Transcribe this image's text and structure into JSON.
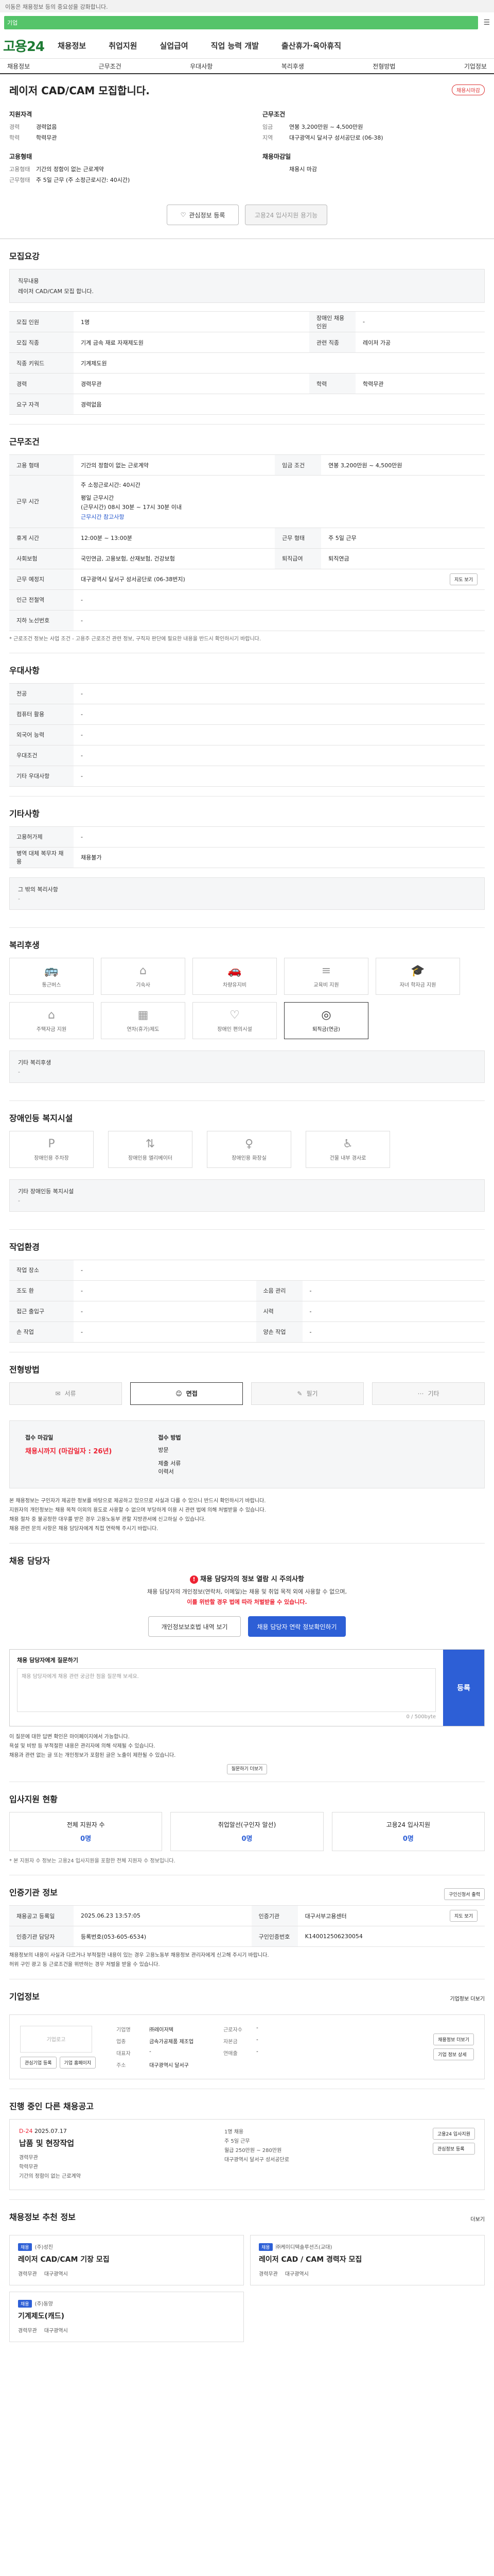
{
  "top_note": "이동은 채용정보 등의 중요성을 강화합니다.",
  "search": {
    "text": "기업"
  },
  "header": {
    "logo": "고용24",
    "nav": [
      "채용정보",
      "취업지원",
      "실업급여",
      "직업 능력 개발",
      "출산휴가·육아휴직"
    ]
  },
  "subnav": [
    "채용정보",
    "근무조건",
    "우대사항",
    "복리후생",
    "전형방법",
    "기업정보"
  ],
  "job": {
    "title": "레이저 CAD/CAM 모집합니다.",
    "badge": "채용시마감",
    "left_groups": [
      {
        "title": "지원자격",
        "rows": [
          {
            "k": "경력",
            "v": "경력없음"
          },
          {
            "k": "학력",
            "v": "학력무관"
          }
        ]
      },
      {
        "title": "고용형태",
        "rows": [
          {
            "k": "고용형태",
            "v": "기간의 정함이 없는 근로계약"
          },
          {
            "k": "근무형태",
            "v": "주 5일 근무 (주 소정근로시간: 40시간)"
          }
        ]
      }
    ],
    "right_groups": [
      {
        "title": "근무조건",
        "rows": [
          {
            "k": "임금",
            "v": "연봉 3,200만원 ~ 4,500만원"
          },
          {
            "k": "지역",
            "v": "대구광역시 달서구 성서공단로 (06-38)"
          }
        ]
      },
      {
        "title": "채용마감일",
        "rows": [
          {
            "k": "",
            "v": "채용시 마감"
          }
        ]
      }
    ],
    "actions": {
      "save": "관심정보 등록",
      "compare": "고용24 입사지원 용기능"
    }
  },
  "recruit": {
    "title": "모집요강",
    "job_label": "직무내용",
    "job_desc": "레이저 CAD/CAM 모집 합니다.",
    "rows": [
      [
        "모집 인원",
        "1명",
        "장애인 채용 인원",
        "-"
      ],
      [
        "모집 직종",
        "기계 금속 재료 자재제도원",
        "관련 직종",
        "레이저 가공"
      ],
      [
        "직종 키워드",
        "기계제도원",
        "",
        ""
      ],
      [
        "경력",
        "경력무관",
        "학력",
        "학력무관"
      ],
      [
        "요구 자격",
        "경력없음",
        "",
        ""
      ]
    ]
  },
  "conditions": {
    "title": "근무조건",
    "rows_top": [
      [
        "고용 형태",
        "기간의 정함이 없는 근로계약",
        "임금 조건",
        "연봉 3,200만원 ~ 4,500만원"
      ]
    ],
    "hours_label": "근무 시간",
    "hours": [
      "주 소정근로시간: 40시간",
      "",
      "평일 근무시간",
      "(근무시간) 08시 30분 ~ 17시 30분 이내",
      "근무시간 참고사항"
    ],
    "rows_mid": [
      [
        "휴게 시간",
        "12:00분 ~ 13:00분",
        "근무 형태",
        "주 5일 근무"
      ],
      [
        "사회보험",
        "국민연금, 고용보험, 산재보험, 건강보험",
        "퇴직급여",
        "퇴직연금"
      ]
    ],
    "address_label": "근무 예정지",
    "address": "대구광역시 달서구 성서공단로 (06-38번지)",
    "map_btn": "지도 보기",
    "rows_bottom": [
      [
        "인근 전철역",
        "-"
      ],
      [
        "지하 노선번호",
        "-"
      ]
    ],
    "note": "* 근로조건 정보는 사업 조건 - 고용주 근로조건 관련 정보, 구직자 판단에 필요한 내용을 반드시 확인하시기 바랍니다."
  },
  "prefer": {
    "title": "우대사항",
    "rows": [
      [
        "전공",
        "-"
      ],
      [
        "컴퓨터 활용",
        "-"
      ],
      [
        "외국어 능력",
        "-"
      ],
      [
        "우대조건",
        "-"
      ],
      [
        "기타 우대사항",
        "-"
      ]
    ]
  },
  "other": {
    "title": "기타사항",
    "rows": [
      [
        "고용허가제",
        "-"
      ],
      [
        "병역 대체 복무자 채용",
        "채용불가"
      ]
    ],
    "etc_label": "그 밖의 복리사항",
    "etc_value": "-"
  },
  "welfare": {
    "title": "복리후생",
    "items": [
      {
        "label": "통근버스",
        "icon": "bus",
        "on": false
      },
      {
        "label": "기숙사",
        "icon": "home",
        "on": false
      },
      {
        "label": "차량유지비",
        "icon": "car",
        "on": false
      },
      {
        "label": "교육비 지원",
        "icon": "book",
        "on": false
      },
      {
        "label": "자녀 학자금 지원",
        "icon": "cap",
        "on": false
      },
      {
        "label": "주택자금 지원",
        "icon": "house",
        "on": false
      },
      {
        "label": "연차(휴가)제도",
        "icon": "calendar",
        "on": false
      },
      {
        "label": "장애인 편의시설",
        "icon": "heart",
        "on": false
      },
      {
        "label": "퇴직금(연금)",
        "icon": "coin",
        "on": true
      }
    ],
    "etc_label": "기타 복리후생",
    "etc_value": "-"
  },
  "disabled": {
    "title": "장애인등 복지시설",
    "items": [
      "장애인용 주차장",
      "장애인용 엘리베이터",
      "장애인용 화장실",
      "건물 내부 경사로"
    ],
    "etc_label": "기타 장애인등 복지시설",
    "etc_value": "-"
  },
  "work_env": {
    "title": "작업환경",
    "rows": [
      [
        "작업 장소",
        "-",
        "",
        ""
      ],
      [
        "조도 환",
        "-",
        "소음 관리",
        "-"
      ],
      [
        "접근 출입구",
        "-",
        "시력",
        "-"
      ],
      [
        "손 작업",
        "-",
        "양손 작업",
        "-"
      ]
    ]
  },
  "method": {
    "title": "전형방법",
    "items": [
      {
        "label": "서류",
        "on": false
      },
      {
        "label": "면접",
        "on": true
      },
      {
        "label": "필기",
        "on": false
      },
      {
        "label": "기타",
        "on": false
      }
    ],
    "deadline_label": "접수 마감일",
    "deadline_value": "채용시까지 (마감일자 : 26년)",
    "way_label": "접수 방법",
    "way_values": [
      "방문",
      "",
      "제출 서류",
      "이력서"
    ],
    "bullets": [
      "본 채용정보는 구인자가 제공한 정보를 바탕으로 제공하고 있으므로 사실과 다를 수 있으니 반드시 확인하시기 바랍니다.",
      "지원자의 개인정보는 채용 목적 이외의 용도로 사용할 수 없으며 부당하게 이용 시 관련 법에 의해 처벌받을 수 있습니다.",
      "채용 절차 중 불공정한 대우를 받은 경우 고용노동부 관할 지방관서에 신고하실 수 있습니다.",
      "채용 관련 문의 사항은 채용 담당자에게 직접 연락해 주시기 바랍니다."
    ]
  },
  "contact": {
    "title": "채용 담당자",
    "warn_title": "채용 담당자의 정보 열람 시 주의사항",
    "warn_lines": [
      "채용 담당자의 개인정보(연락처, 이메일)는 채용 및 취업 목적 외에 사용할 수 없으며,",
      "이를 위반할 경우 법에 따라 처벌받을 수 있습니다."
    ],
    "btn_private": "개인정보보호법 내역 보기",
    "btn_view": "채용 담당자 연락 정보확인하기",
    "qa_label": "채용 담당자에게 질문하기",
    "qa_placeholder": "채용 담당자에게 채용 관련 궁금한 점을 질문해 보세요.",
    "qa_count": "0 / 500byte",
    "qa_submit": "등록",
    "bullets": [
      "이 질문에 대한 답변 확인은 마이페이지에서 가능합니다.",
      "욕설 및 비방 등 부적절한 내용은 관리자에 의해 삭제될 수 있습니다.",
      "채용과 관련 없는 글 또는 개인정보가 포함된 글은 노출이 제한될 수 있습니다."
    ],
    "more_btn": "질문하기 더보기"
  },
  "apply_status": {
    "title": "입사지원 현황",
    "items": [
      {
        "label": "전체 지원자 수",
        "value": "0명"
      },
      {
        "label": "취업알선(구인자 알선)",
        "value": "0명"
      },
      {
        "label": "고용24 입사지원",
        "value": "0명"
      }
    ],
    "note": "* 본 지원자 수 정보는 고용24 입사지원을 포함한 전체 지원자 수 정보입니다."
  },
  "info": {
    "title": "인증기관 정보",
    "print_btn": "구인신청서 출력",
    "rows": [
      [
        "채용공고 등록일",
        "2025.06.23 13:57:05",
        "인증기관",
        "대구서부고용센터",
        "지도 보기"
      ],
      [
        "인증기관 담당자",
        "등록번호(053-605-6534)",
        "구인인증번호",
        "K140012506230054"
      ]
    ],
    "bullets": [
      "채용정보의 내용이 사실과 다르거나 부적절한 내용이 있는 경우 고용노동부 채용정보 관리자에게 신고해 주시기 바랍니다.",
      "허위 구인 광고 등 근로조건을 위반하는 경우 처벌을 받을 수 있습니다."
    ]
  },
  "company": {
    "title": "기업정보",
    "more": "기업정보 더보기",
    "logo_text": "기업로고",
    "btn_save": "관심기업 등록",
    "btn_home": "기업 홈페이지",
    "kv": [
      [
        "기업명",
        "㈜레이저텍",
        "근로자수",
        "-"
      ],
      [
        "업종",
        "금속가공제품 제조업",
        "자본금",
        "-"
      ],
      [
        "대표자",
        "-",
        "연매출",
        "-"
      ],
      [
        "주소",
        "대구광역시 달서구",
        "",
        ""
      ]
    ],
    "right_btns": [
      "채용정보 더보기",
      "기업 정보 상세"
    ]
  },
  "recent": {
    "title": "진행 중인 다른 채용공고",
    "days": "D-24",
    "date": "2025.07.17",
    "job_title": "납품 및 현장작업",
    "meta_left": [
      "경력무관",
      "학력무관",
      "기간의 정함이 없는 근로계약"
    ],
    "meta_right": [
      "1명 채용",
      "주 5일 근무",
      "월급 250만원 ~ 280만원",
      "대구광역시 달서구 성서공단로"
    ],
    "btn_apply": "고용24 입사지원",
    "btn_save": "관심정보 등록"
  },
  "recommend": {
    "title": "채용정보 추천 정보",
    "more": "더보기",
    "cards": [
      {
        "tag": "채용",
        "company": "(주)성진",
        "title": "레이저 CAD/CAM 기장 모집",
        "meta": [
          "경력무관",
          "대구광역시"
        ]
      },
      {
        "tag": "채용",
        "company": "㈜케이디텍솔루션즈(교대)",
        "title": "레이저 CAD / CAM 경력자 모집",
        "meta": [
          "경력무관",
          "대구광역시"
        ]
      },
      {
        "tag": "채용",
        "company": "(주)동양",
        "title": "기계제도(캐드)",
        "meta": [
          "경력무관",
          "대구광역시"
        ]
      }
    ]
  },
  "colors": {
    "brand": "#1e7b34",
    "accent": "#2d5fd6",
    "alert": "#e23"
  }
}
